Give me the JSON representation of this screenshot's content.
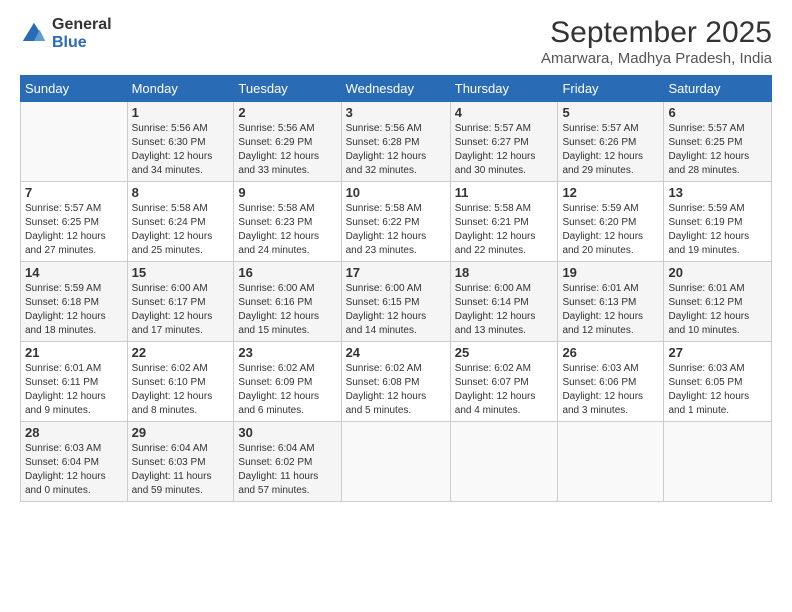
{
  "logo": {
    "line1": "General",
    "line2": "Blue"
  },
  "title": "September 2025",
  "subtitle": "Amarwara, Madhya Pradesh, India",
  "weekdays": [
    "Sunday",
    "Monday",
    "Tuesday",
    "Wednesday",
    "Thursday",
    "Friday",
    "Saturday"
  ],
  "weeks": [
    [
      {
        "day": "",
        "info": ""
      },
      {
        "day": "1",
        "info": "Sunrise: 5:56 AM\nSunset: 6:30 PM\nDaylight: 12 hours\nand 34 minutes."
      },
      {
        "day": "2",
        "info": "Sunrise: 5:56 AM\nSunset: 6:29 PM\nDaylight: 12 hours\nand 33 minutes."
      },
      {
        "day": "3",
        "info": "Sunrise: 5:56 AM\nSunset: 6:28 PM\nDaylight: 12 hours\nand 32 minutes."
      },
      {
        "day": "4",
        "info": "Sunrise: 5:57 AM\nSunset: 6:27 PM\nDaylight: 12 hours\nand 30 minutes."
      },
      {
        "day": "5",
        "info": "Sunrise: 5:57 AM\nSunset: 6:26 PM\nDaylight: 12 hours\nand 29 minutes."
      },
      {
        "day": "6",
        "info": "Sunrise: 5:57 AM\nSunset: 6:25 PM\nDaylight: 12 hours\nand 28 minutes."
      }
    ],
    [
      {
        "day": "7",
        "info": "Sunrise: 5:57 AM\nSunset: 6:25 PM\nDaylight: 12 hours\nand 27 minutes."
      },
      {
        "day": "8",
        "info": "Sunrise: 5:58 AM\nSunset: 6:24 PM\nDaylight: 12 hours\nand 25 minutes."
      },
      {
        "day": "9",
        "info": "Sunrise: 5:58 AM\nSunset: 6:23 PM\nDaylight: 12 hours\nand 24 minutes."
      },
      {
        "day": "10",
        "info": "Sunrise: 5:58 AM\nSunset: 6:22 PM\nDaylight: 12 hours\nand 23 minutes."
      },
      {
        "day": "11",
        "info": "Sunrise: 5:58 AM\nSunset: 6:21 PM\nDaylight: 12 hours\nand 22 minutes."
      },
      {
        "day": "12",
        "info": "Sunrise: 5:59 AM\nSunset: 6:20 PM\nDaylight: 12 hours\nand 20 minutes."
      },
      {
        "day": "13",
        "info": "Sunrise: 5:59 AM\nSunset: 6:19 PM\nDaylight: 12 hours\nand 19 minutes."
      }
    ],
    [
      {
        "day": "14",
        "info": "Sunrise: 5:59 AM\nSunset: 6:18 PM\nDaylight: 12 hours\nand 18 minutes."
      },
      {
        "day": "15",
        "info": "Sunrise: 6:00 AM\nSunset: 6:17 PM\nDaylight: 12 hours\nand 17 minutes."
      },
      {
        "day": "16",
        "info": "Sunrise: 6:00 AM\nSunset: 6:16 PM\nDaylight: 12 hours\nand 15 minutes."
      },
      {
        "day": "17",
        "info": "Sunrise: 6:00 AM\nSunset: 6:15 PM\nDaylight: 12 hours\nand 14 minutes."
      },
      {
        "day": "18",
        "info": "Sunrise: 6:00 AM\nSunset: 6:14 PM\nDaylight: 12 hours\nand 13 minutes."
      },
      {
        "day": "19",
        "info": "Sunrise: 6:01 AM\nSunset: 6:13 PM\nDaylight: 12 hours\nand 12 minutes."
      },
      {
        "day": "20",
        "info": "Sunrise: 6:01 AM\nSunset: 6:12 PM\nDaylight: 12 hours\nand 10 minutes."
      }
    ],
    [
      {
        "day": "21",
        "info": "Sunrise: 6:01 AM\nSunset: 6:11 PM\nDaylight: 12 hours\nand 9 minutes."
      },
      {
        "day": "22",
        "info": "Sunrise: 6:02 AM\nSunset: 6:10 PM\nDaylight: 12 hours\nand 8 minutes."
      },
      {
        "day": "23",
        "info": "Sunrise: 6:02 AM\nSunset: 6:09 PM\nDaylight: 12 hours\nand 6 minutes."
      },
      {
        "day": "24",
        "info": "Sunrise: 6:02 AM\nSunset: 6:08 PM\nDaylight: 12 hours\nand 5 minutes."
      },
      {
        "day": "25",
        "info": "Sunrise: 6:02 AM\nSunset: 6:07 PM\nDaylight: 12 hours\nand 4 minutes."
      },
      {
        "day": "26",
        "info": "Sunrise: 6:03 AM\nSunset: 6:06 PM\nDaylight: 12 hours\nand 3 minutes."
      },
      {
        "day": "27",
        "info": "Sunrise: 6:03 AM\nSunset: 6:05 PM\nDaylight: 12 hours\nand 1 minute."
      }
    ],
    [
      {
        "day": "28",
        "info": "Sunrise: 6:03 AM\nSunset: 6:04 PM\nDaylight: 12 hours\nand 0 minutes."
      },
      {
        "day": "29",
        "info": "Sunrise: 6:04 AM\nSunset: 6:03 PM\nDaylight: 11 hours\nand 59 minutes."
      },
      {
        "day": "30",
        "info": "Sunrise: 6:04 AM\nSunset: 6:02 PM\nDaylight: 11 hours\nand 57 minutes."
      },
      {
        "day": "",
        "info": ""
      },
      {
        "day": "",
        "info": ""
      },
      {
        "day": "",
        "info": ""
      },
      {
        "day": "",
        "info": ""
      }
    ]
  ]
}
